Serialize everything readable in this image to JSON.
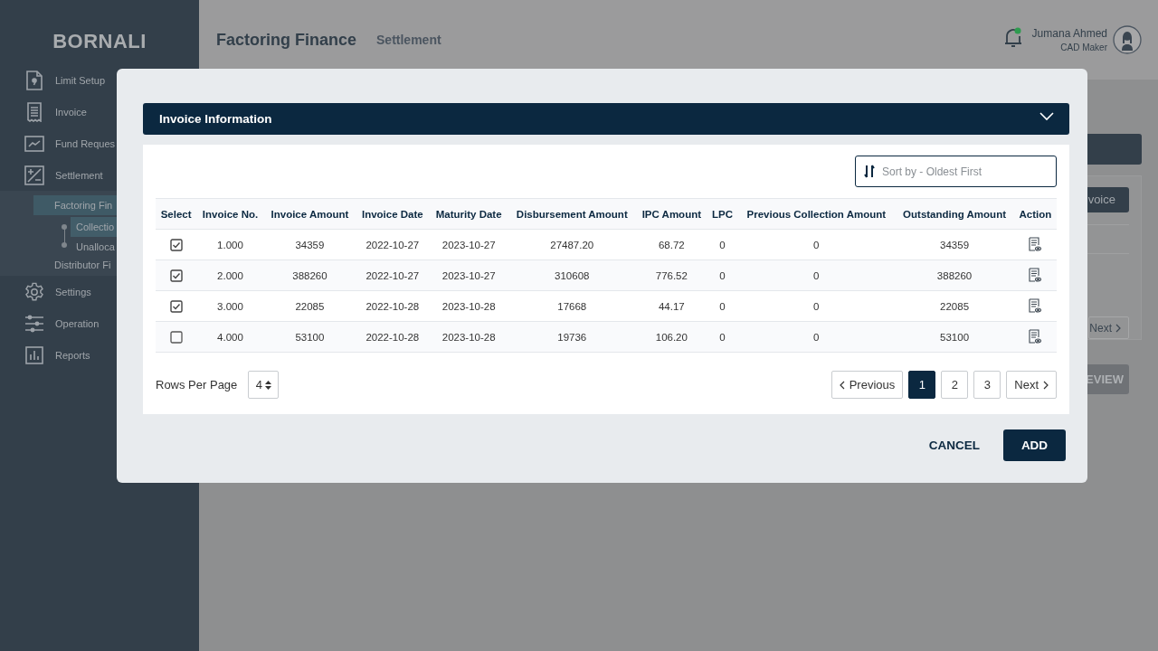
{
  "sidebar": {
    "logo": "BORNALI",
    "items": [
      {
        "label": "Limit Setup",
        "selected": false
      },
      {
        "label": "Invoice",
        "selected": false
      },
      {
        "label": "Fund Reques",
        "selected": false
      },
      {
        "label": "Settlement",
        "selected": false,
        "expanded": true,
        "children": [
          {
            "label": "Factoring Fin",
            "selected": true,
            "expanded": true,
            "children": [
              {
                "label": "Collectio",
                "selected": true
              },
              {
                "label": "Unalloca",
                "selected": false
              }
            ]
          },
          {
            "label": "Distributor Fi",
            "selected": false
          }
        ]
      },
      {
        "label": "Settings",
        "selected": false
      },
      {
        "label": "Operation",
        "selected": false
      },
      {
        "label": "Reports",
        "selected": false
      }
    ]
  },
  "header": {
    "title": "Factoring Finance",
    "subtitle": "Settlement",
    "user": {
      "name": "Jumana Ahmed",
      "role": "CAD Maker",
      "notification": true
    }
  },
  "background": {
    "panel_button": "voice",
    "panel_next": "Next",
    "action_button": "EVIEW"
  },
  "modal": {
    "section": {
      "title": "Invoice Information",
      "expanded": true
    },
    "sort": {
      "placeholder": "Sort by - Oldest First"
    },
    "table": {
      "columns": [
        "Select",
        "Invoice No.",
        "Invoice Amount",
        "Invoice Date",
        "Maturity Date",
        "Disbursement Amount",
        "IPC Amount",
        "LPC",
        "Previous Collection Amount",
        "Outstanding Amount",
        "Action"
      ],
      "rows": [
        {
          "selected": true,
          "cells": [
            "",
            "1.000",
            "34359",
            "2022-10-27",
            "2023-10-27",
            "27487.20",
            "68.72",
            "0",
            "0",
            "34359",
            ""
          ]
        },
        {
          "selected": true,
          "cells": [
            "",
            "2.000",
            "388260",
            "2022-10-27",
            "2023-10-27",
            "310608",
            "776.52",
            "0",
            "0",
            "388260",
            ""
          ]
        },
        {
          "selected": true,
          "cells": [
            "",
            "3.000",
            "22085",
            "2022-10-28",
            "2023-10-28",
            "17668",
            "44.17",
            "0",
            "0",
            "22085",
            ""
          ]
        },
        {
          "selected": false,
          "cells": [
            "",
            "4.000",
            "53100",
            "2022-10-28",
            "2023-10-28",
            "19736",
            "106.20",
            "0",
            "0",
            "53100",
            ""
          ]
        }
      ]
    },
    "rows_per_page": {
      "label": "Rows Per Page",
      "value": "4"
    },
    "pagination": {
      "previous": "Previous",
      "pages": [
        {
          "label": "1",
          "selected": true
        },
        {
          "label": "2",
          "selected": false
        },
        {
          "label": "3",
          "selected": false
        }
      ],
      "next": "Next"
    },
    "buttons": {
      "cancel": "CANCEL",
      "add": "ADD"
    }
  }
}
